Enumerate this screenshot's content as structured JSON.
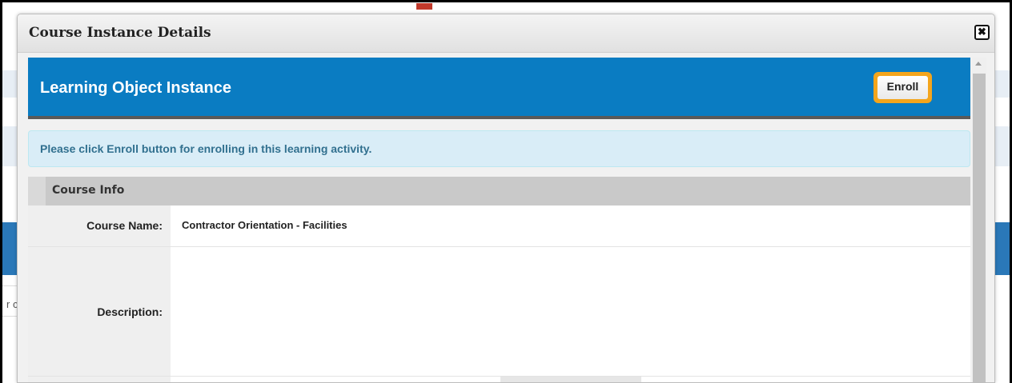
{
  "background": {
    "left_fragment": "r c"
  },
  "modal": {
    "title": "Course Instance Details",
    "close_icon": "close-icon"
  },
  "learning_object": {
    "title": "Learning Object Instance",
    "enroll_label": "Enroll"
  },
  "alert": {
    "message": "Please click Enroll button for enrolling in this learning activity."
  },
  "course_info": {
    "section_title": "Course Info",
    "fields": [
      {
        "label": "Course Name:",
        "value": "Contractor Orientation - Facilities"
      },
      {
        "label": "Description:",
        "value": ""
      }
    ]
  },
  "colors": {
    "header_blue": "#0a7cc2",
    "enroll_highlight": "#f4a51c",
    "alert_bg": "#d9edf7",
    "alert_text": "#31708f"
  }
}
